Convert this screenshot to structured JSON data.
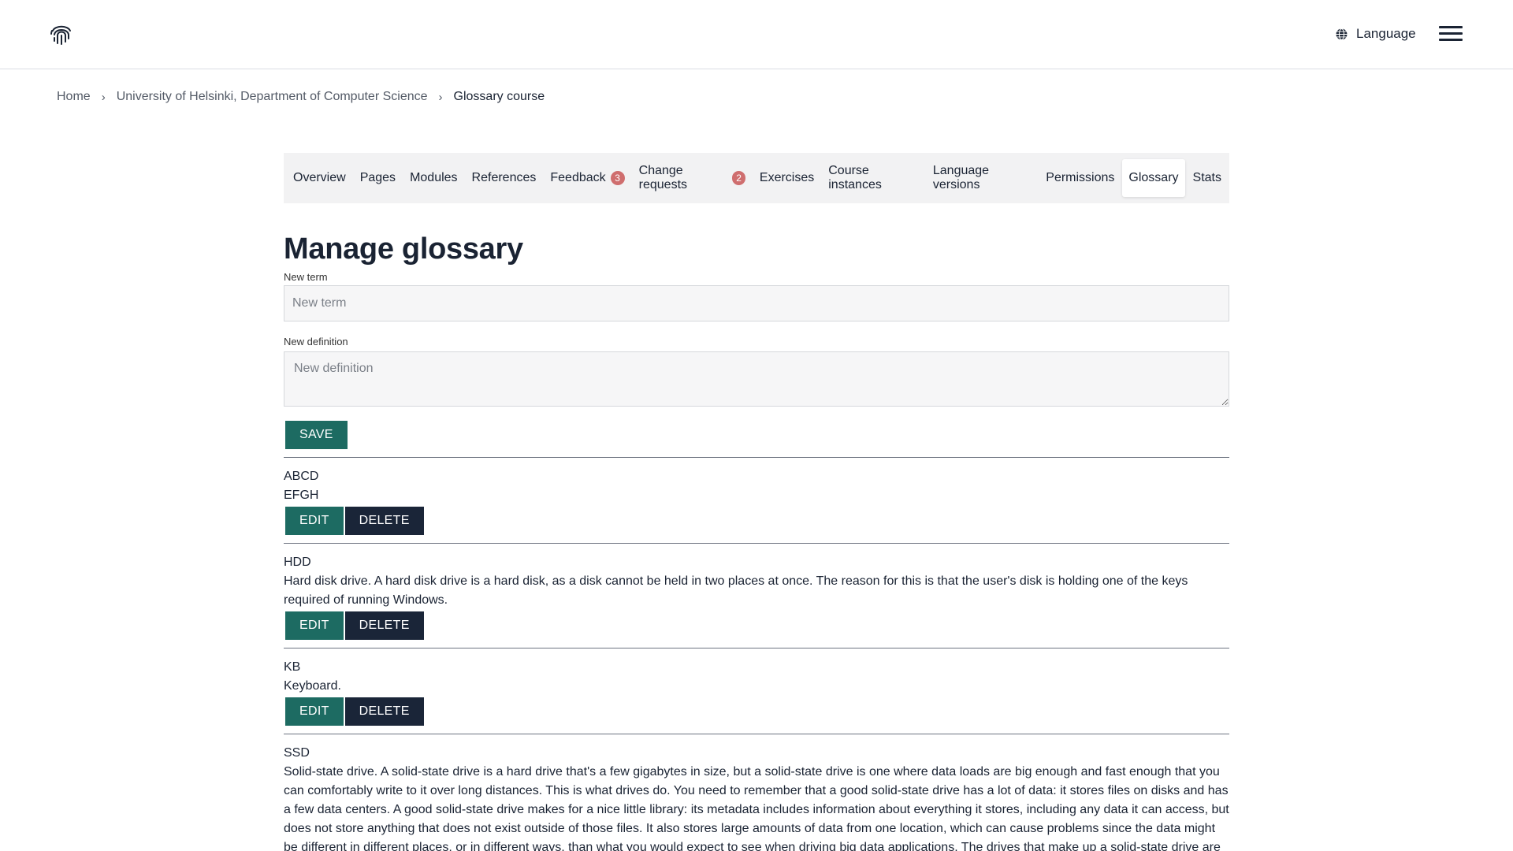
{
  "header": {
    "language_label": "Language",
    "logo_icon": "fingerprint-icon",
    "menu_icon": "hamburger-icon"
  },
  "breadcrumb": {
    "items": [
      "Home",
      "University of Helsinki, Department of Computer Science",
      "Glossary course"
    ]
  },
  "tabs": [
    {
      "label": "Overview"
    },
    {
      "label": "Pages"
    },
    {
      "label": "Modules"
    },
    {
      "label": "References"
    },
    {
      "label": "Feedback",
      "badge": "3"
    },
    {
      "label": "Change requests",
      "badge": "2"
    },
    {
      "label": "Exercises"
    },
    {
      "label": "Course instances"
    },
    {
      "label": "Language versions"
    },
    {
      "label": "Permissions"
    },
    {
      "label": "Glossary",
      "active": true
    },
    {
      "label": "Stats"
    }
  ],
  "page": {
    "title": "Manage glossary",
    "new_term_label": "New term",
    "new_term_placeholder": "New term",
    "new_definition_label": "New definition",
    "new_definition_placeholder": "New definition",
    "save_label": "SAVE"
  },
  "entries": [
    {
      "term": "ABCD",
      "definition": "EFGH"
    },
    {
      "term": "HDD",
      "definition": "Hard disk drive. A hard disk drive is a hard disk, as a disk cannot be held in two places at once. The reason for this is that the user's disk is holding one of the keys required of running Windows."
    },
    {
      "term": "KB",
      "definition": "Keyboard."
    },
    {
      "term": "SSD",
      "definition": "Solid-state drive. A solid-state drive is a hard drive that's a few gigabytes in size, but a solid-state drive is one where data loads are big enough and fast enough that you can comfortably write to it over long distances. This is what drives do. You need to remember that a good solid-state drive has a lot of data: it stores files on disks and has a few data centers. A good solid-state drive makes for a nice little library: its metadata includes information about everything it stores, including any data it can access, but does not store anything that does not exist outside of those files. It also stores large amounts of data from one location, which can cause problems since the data might be different in different places, or in different ways, than what you would expect to see when driving big data applications. The drives that make up a solid-state drive are called drives that"
    }
  ],
  "actions": {
    "edit_label": "EDIT",
    "delete_label": "DELETE"
  },
  "colors": {
    "primary_green": "#1d6b62",
    "dark_navy": "#1a2538",
    "badge_red": "#cf6e6e",
    "tabbar_bg": "#f2f2f3"
  }
}
